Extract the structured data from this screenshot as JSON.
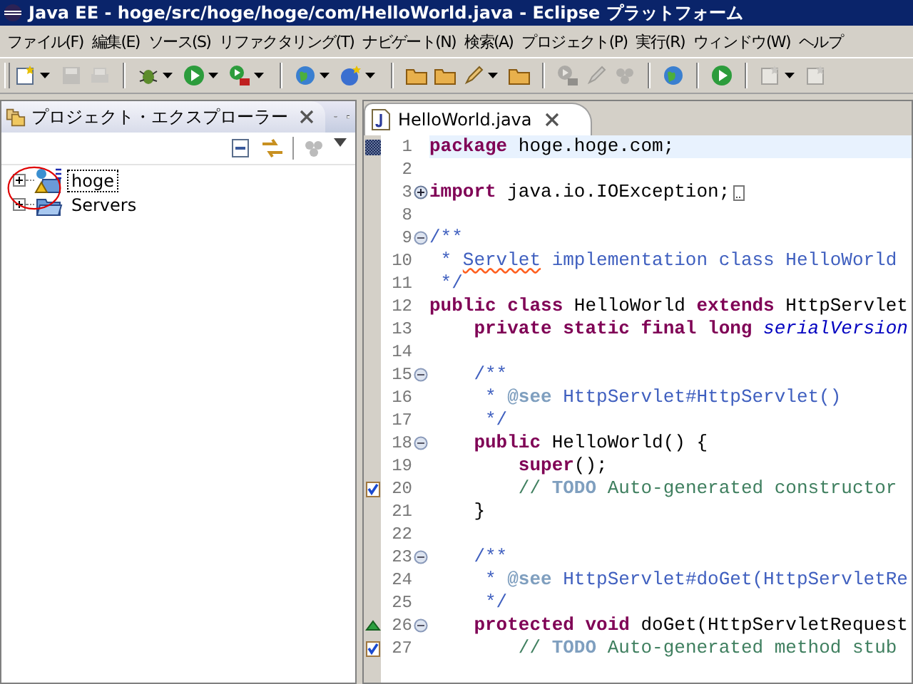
{
  "window": {
    "title": "Java EE - hoge/src/hoge/hoge/com/HelloWorld.java - Eclipse プラットフォーム"
  },
  "menu": [
    "ファイル(F)",
    "編集(E)",
    "ソース(S)",
    "リファクタリング(T)",
    "ナビゲート(N)",
    "検索(A)",
    "プロジェクト(P)",
    "実行(R)",
    "ウィンドウ(W)",
    "ヘルプ"
  ],
  "toolbar": [
    {
      "kind": "new",
      "disabled": false,
      "dropdown": true
    },
    {
      "kind": "save",
      "disabled": true,
      "dropdown": false
    },
    {
      "kind": "print",
      "disabled": true,
      "dropdown": false
    },
    {
      "kind": "sep"
    },
    {
      "kind": "debug",
      "disabled": false,
      "dropdown": true
    },
    {
      "kind": "run",
      "disabled": false,
      "dropdown": true
    },
    {
      "kind": "tool",
      "disabled": false,
      "dropdown": true
    },
    {
      "kind": "sep"
    },
    {
      "kind": "globe",
      "disabled": false,
      "dropdown": true
    },
    {
      "kind": "server",
      "disabled": false,
      "dropdown": true
    },
    {
      "kind": "sep"
    },
    {
      "kind": "folder",
      "disabled": false,
      "dropdown": false
    },
    {
      "kind": "folder",
      "disabled": false,
      "dropdown": false
    },
    {
      "kind": "pen",
      "disabled": false,
      "dropdown": true
    },
    {
      "kind": "folder",
      "disabled": false,
      "dropdown": false
    },
    {
      "kind": "sep"
    },
    {
      "kind": "tool",
      "disabled": true,
      "dropdown": false
    },
    {
      "kind": "pen",
      "disabled": true,
      "dropdown": false
    },
    {
      "kind": "dots",
      "disabled": true,
      "dropdown": false
    },
    {
      "kind": "sep"
    },
    {
      "kind": "globe",
      "disabled": false,
      "dropdown": false
    },
    {
      "kind": "sep"
    },
    {
      "kind": "run",
      "disabled": false,
      "dropdown": false
    },
    {
      "kind": "sep"
    },
    {
      "kind": "new",
      "disabled": true,
      "dropdown": true
    },
    {
      "kind": "new",
      "disabled": true,
      "dropdown": false
    }
  ],
  "explorer": {
    "title": "プロジェクト・エクスプローラー",
    "tree": [
      {
        "label": "hoge",
        "kind": "project",
        "expanded": false,
        "selected": true,
        "warning": true
      },
      {
        "label": "Servers",
        "kind": "folder",
        "expanded": false,
        "selected": false,
        "warning": false
      }
    ]
  },
  "editor": {
    "tab": {
      "label": "HelloWorld.java"
    },
    "lines": [
      {
        "n": "1",
        "kind": "bookmark",
        "current": true,
        "tokens": [
          {
            "kind": "keyword",
            "text": "package"
          },
          {
            "kind": "plain",
            "text": " hoge.hoge.com;"
          }
        ]
      },
      {
        "n": "2",
        "kind": "code",
        "current": false
      },
      {
        "n": "3",
        "kind": "code",
        "current": false,
        "expanded": false,
        "tokens": [
          {
            "kind": "keyword",
            "text": "import"
          },
          {
            "kind": "plain",
            "text": " java.io.IOException;"
          }
        ]
      },
      {
        "n": "8",
        "kind": "code",
        "current": false
      },
      {
        "n": "9",
        "kind": "code",
        "current": false,
        "expanded": true,
        "tokens": [
          {
            "kind": "javadoc",
            "text": "/**"
          }
        ]
      },
      {
        "n": "10",
        "kind": "code",
        "current": false,
        "tokens": [
          {
            "kind": "javadoc",
            "text": " * "
          },
          {
            "kind": "misspelled",
            "text": "Servlet"
          },
          {
            "kind": "javadoc",
            "text": " implementation class HelloWorld"
          }
        ]
      },
      {
        "n": "11",
        "kind": "code",
        "current": false,
        "tokens": [
          {
            "kind": "javadoc",
            "text": " */"
          }
        ]
      },
      {
        "n": "12",
        "kind": "code",
        "current": false,
        "tokens": [
          {
            "kind": "keyword",
            "text": "public class"
          },
          {
            "kind": "plain",
            "text": " HelloWorld "
          },
          {
            "kind": "keyword",
            "text": "extends"
          },
          {
            "kind": "plain",
            "text": " HttpServlet"
          }
        ]
      },
      {
        "n": "13",
        "kind": "code",
        "current": false,
        "tokens": [
          {
            "kind": "keyword",
            "text": "    private static final long"
          },
          {
            "kind": "field",
            "text": " serialVersion"
          }
        ]
      },
      {
        "n": "14",
        "kind": "code",
        "current": false
      },
      {
        "n": "15",
        "kind": "code",
        "current": false,
        "expanded": true,
        "tokens": [
          {
            "kind": "javadoc",
            "text": "    /**"
          }
        ]
      },
      {
        "n": "16",
        "kind": "code",
        "current": false,
        "tokens": [
          {
            "kind": "javadoc",
            "text": "     * "
          },
          {
            "kind": "tag",
            "text": "@see"
          },
          {
            "kind": "javadoc",
            "text": " HttpServlet#HttpServlet()"
          }
        ]
      },
      {
        "n": "17",
        "kind": "code",
        "current": false,
        "tokens": [
          {
            "kind": "javadoc",
            "text": "     */"
          }
        ]
      },
      {
        "n": "18",
        "kind": "code",
        "current": false,
        "expanded": true,
        "tokens": [
          {
            "kind": "keyword",
            "text": "    public"
          },
          {
            "kind": "plain",
            "text": " HelloWorld() {"
          }
        ]
      },
      {
        "n": "19",
        "kind": "code",
        "current": false,
        "tokens": [
          {
            "kind": "keyword",
            "text": "        super"
          },
          {
            "kind": "plain",
            "text": "();"
          }
        ]
      },
      {
        "n": "20",
        "kind": "task",
        "current": false,
        "tokens": [
          {
            "kind": "comment",
            "text": "        // "
          },
          {
            "kind": "tag",
            "text": "TODO"
          },
          {
            "kind": "comment",
            "text": " Auto-generated constructor"
          }
        ]
      },
      {
        "n": "21",
        "kind": "code",
        "current": false,
        "tokens": [
          {
            "kind": "plain",
            "text": "    }"
          }
        ]
      },
      {
        "n": "22",
        "kind": "code",
        "current": false
      },
      {
        "n": "23",
        "kind": "code",
        "current": false,
        "expanded": true,
        "tokens": [
          {
            "kind": "javadoc",
            "text": "    /**"
          }
        ]
      },
      {
        "n": "24",
        "kind": "code",
        "current": false,
        "tokens": [
          {
            "kind": "javadoc",
            "text": "     * "
          },
          {
            "kind": "tag",
            "text": "@see"
          },
          {
            "kind": "javadoc",
            "text": " HttpServlet#doGet(HttpServletRe"
          }
        ]
      },
      {
        "n": "25",
        "kind": "code",
        "current": false,
        "tokens": [
          {
            "kind": "javadoc",
            "text": "     */"
          }
        ]
      },
      {
        "n": "26",
        "kind": "override",
        "current": false,
        "expanded": true,
        "tokens": [
          {
            "kind": "keyword",
            "text": "    protected void"
          },
          {
            "kind": "plain",
            "text": " doGet(HttpServletRequest"
          }
        ]
      },
      {
        "n": "27",
        "kind": "task",
        "current": false,
        "tokens": [
          {
            "kind": "comment",
            "text": "        // "
          },
          {
            "kind": "tag",
            "text": "TODO"
          },
          {
            "kind": "comment",
            "text": " Auto-generated method stub"
          }
        ]
      }
    ]
  }
}
